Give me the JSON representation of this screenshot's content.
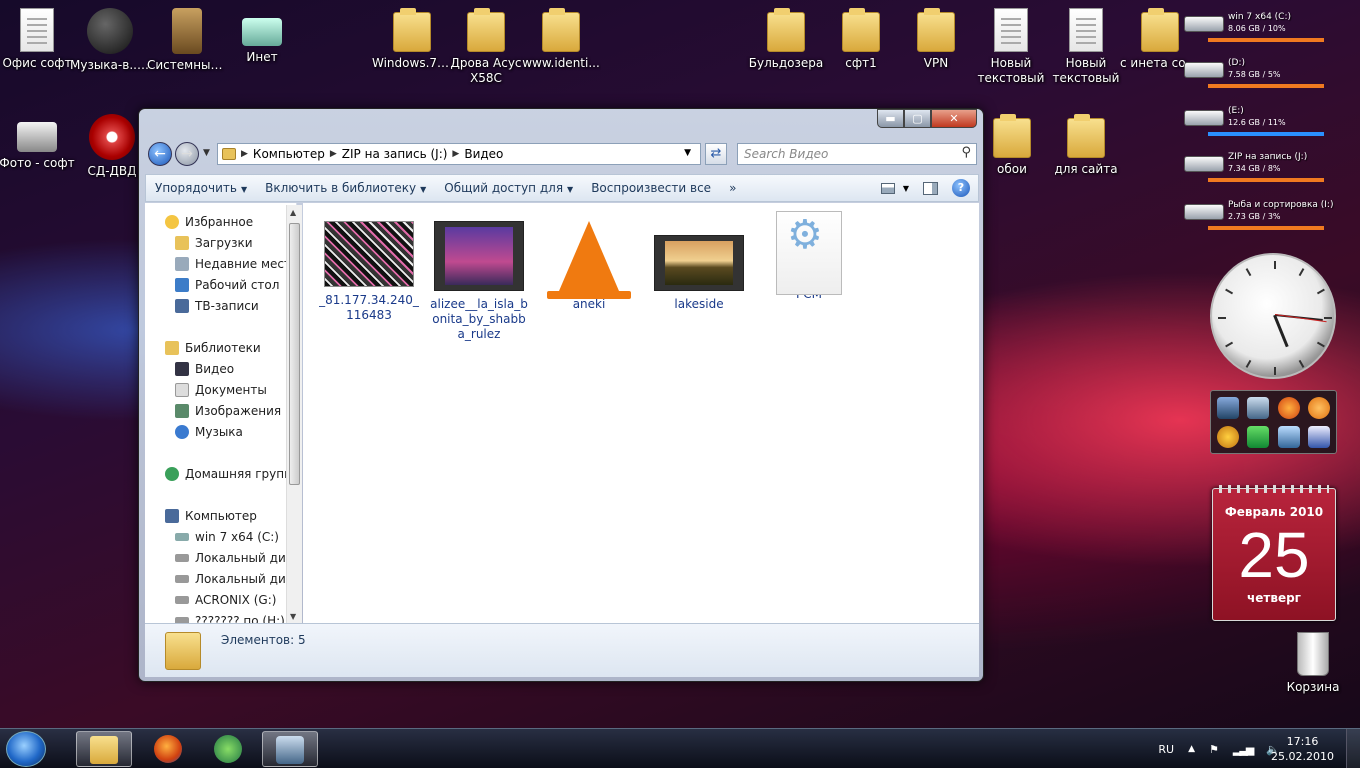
{
  "desktop": {
    "icons": [
      {
        "label": "Офис софт",
        "icon": "notepad-icon"
      },
      {
        "label": "Музыка-в... софт",
        "icon": "headphones-icon"
      },
      {
        "label": "Системный - софт",
        "icon": "device-icon"
      },
      {
        "label": "Инет",
        "icon": "network-cable-icon"
      },
      {
        "label": "Фото - софт",
        "icon": "scanner-icon"
      },
      {
        "label": "СД-ДВД",
        "icon": "disc-icon"
      },
      {
        "label": "Windows.7....",
        "icon": "folder-icon"
      },
      {
        "label": "Дрова Асус X58C",
        "icon": "folder-icon"
      },
      {
        "label": "www.identi...",
        "icon": "folder-icon"
      },
      {
        "label": "Бульдозера",
        "icon": "folder-icon"
      },
      {
        "label": "сфт1",
        "icon": "folder-icon"
      },
      {
        "label": "VPN",
        "icon": "folder-icon"
      },
      {
        "label": "Новый текстовый ...",
        "icon": "text-document-icon"
      },
      {
        "label": "Новый текстовый ...",
        "icon": "text-document-icon"
      },
      {
        "label": "с инета софт",
        "icon": "folder-icon"
      },
      {
        "label": "обои",
        "icon": "folder-icon"
      },
      {
        "label": "для сайта",
        "icon": "folder-icon"
      },
      {
        "label": "Корзина",
        "icon": "recycle-bin-icon"
      }
    ]
  },
  "window": {
    "caption_buttons": {
      "minimize": "▬",
      "maximize": "▢",
      "close": "✕"
    },
    "breadcrumb": [
      "Компьютер",
      "ZIP на запись (J:)",
      "Видео"
    ],
    "search_placeholder": "Search Видео",
    "toolbar": {
      "organize": "Упорядочить",
      "include": "Включить в библиотеку",
      "share": "Общий доступ для",
      "play_all": "Воспроизвести все",
      "more": "»"
    },
    "nav": {
      "favorites": "Избранное",
      "downloads": "Загрузки",
      "recent": "Недавние места",
      "desktop": "Рабочий стол",
      "tv": "ТВ-записи",
      "libraries": "Библиотеки",
      "video": "Видео",
      "documents": "Документы",
      "images": "Изображения",
      "music": "Музыка",
      "homegroup": "Домашняя группа",
      "computer": "Компьютер",
      "drive_c": "win 7 x64 (C:)",
      "local1": "Локальный диск",
      "local2": "Локальный диск",
      "acronix": "ACRONIX (G:)",
      "drive_h": "??????? по (H:)"
    },
    "files": [
      {
        "name": "_81.177.34.240_116483",
        "thumb": "noise-video-thumb"
      },
      {
        "name": "alizee__la_isla_bonita_by_shabba_rulez",
        "thumb": "concert-video-thumb"
      },
      {
        "name": "aneki",
        "thumb": "vlc-cone-icon"
      },
      {
        "name": "lakeside",
        "thumb": "lakeside-video-thumb"
      },
      {
        "name": "PCM",
        "thumb": "gear-file-icon"
      }
    ],
    "status": "Элементов: 5"
  },
  "drives": [
    {
      "name": "win 7 x64 (C:)",
      "size": "8.06 GB / 10%",
      "bar_color": "#f07a20",
      "usage": 10
    },
    {
      "name": "(D:)",
      "size": "7.58 GB / 5%",
      "bar_color": "#f07a20",
      "usage": 5
    },
    {
      "name": "(E:)",
      "size": "12.6 GB / 11%",
      "bar_color": "#2a90ff",
      "usage": 11
    },
    {
      "name": "ZIP на запись (J:)",
      "size": "7.34 GB / 8%",
      "bar_color": "#f07a20",
      "usage": 8
    },
    {
      "name": "Рыба и сортировка (I:)",
      "size": "2.73 GB / 3%",
      "bar_color": "#f07a20",
      "usage": 3
    }
  ],
  "clock": {
    "hours": 17,
    "minutes": 16
  },
  "calendar": {
    "month": "Февраль 2010",
    "day": "25",
    "weekday": "четверг"
  },
  "taskbar": {
    "lang": "RU",
    "time": "17:16",
    "date": "25.02.2010"
  }
}
